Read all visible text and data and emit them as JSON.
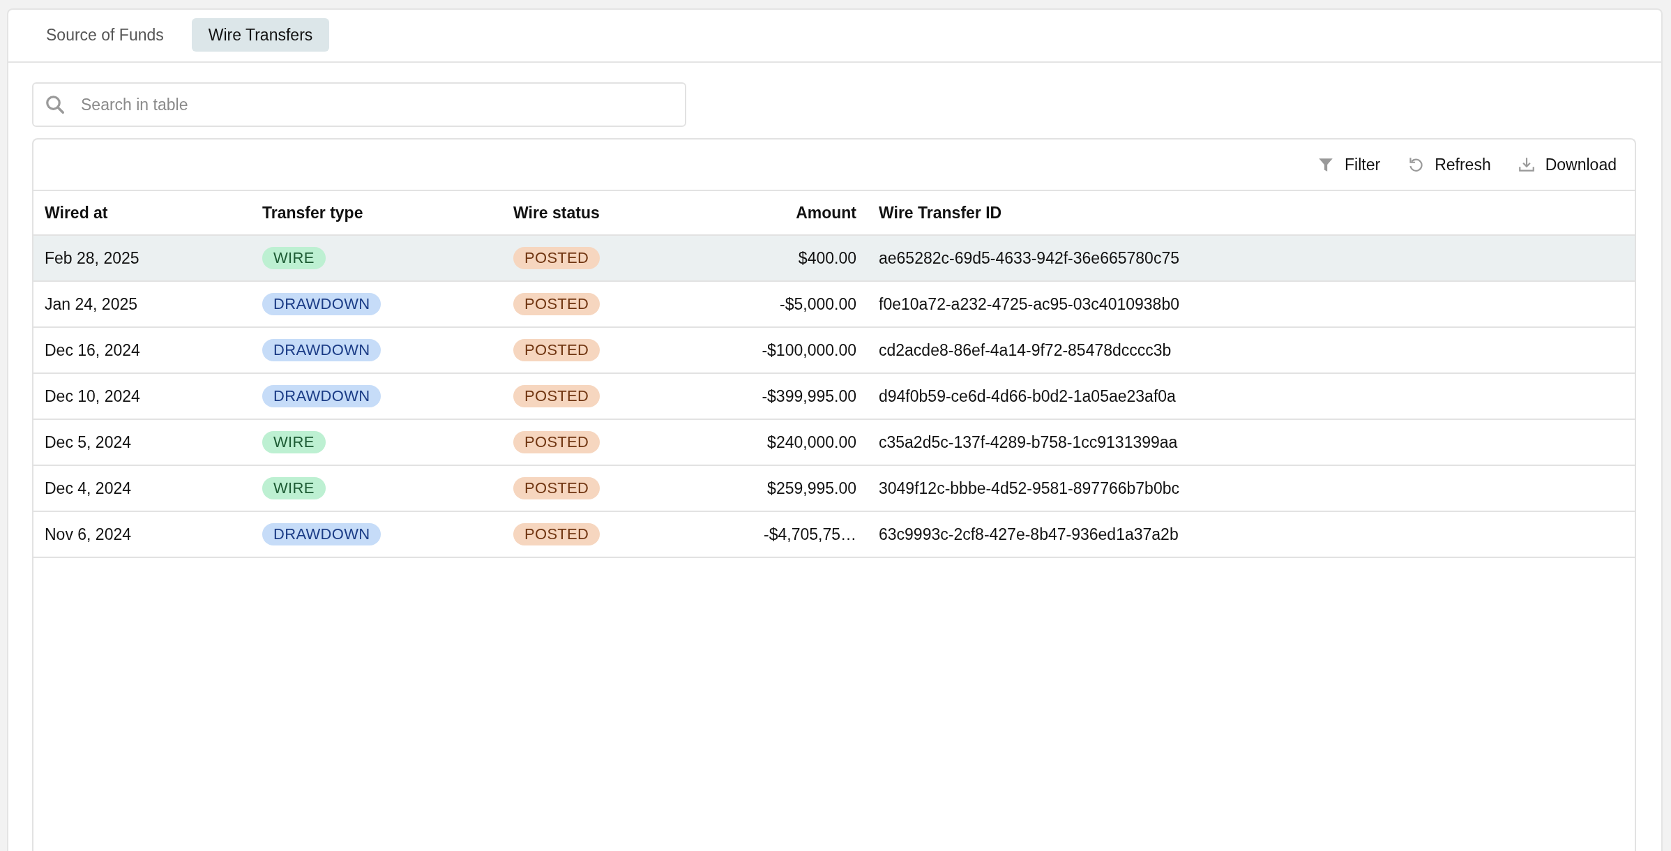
{
  "tabs": [
    {
      "label": "Source of Funds",
      "selected": false
    },
    {
      "label": "Wire Transfers",
      "selected": true
    }
  ],
  "search": {
    "placeholder": "Search in table"
  },
  "toolbar": [
    {
      "kind": "filter",
      "label": "Filter"
    },
    {
      "kind": "refresh",
      "label": "Refresh"
    },
    {
      "kind": "download",
      "label": "Download"
    }
  ],
  "table": {
    "columns": [
      "Wired at",
      "Transfer type",
      "Wire status",
      "Amount",
      "Wire Transfer ID"
    ],
    "rows": [
      {
        "wired_at": "Feb 28, 2025",
        "transfer_type": {
          "kind": "wire",
          "label": "WIRE"
        },
        "wire_status": {
          "kind": "posted",
          "label": "POSTED"
        },
        "amount": "$400.00",
        "id": "ae65282c-69d5-4633-942f-36e665780c75",
        "selected": true
      },
      {
        "wired_at": "Jan 24, 2025",
        "transfer_type": {
          "kind": "drawdown",
          "label": "DRAWDOWN"
        },
        "wire_status": {
          "kind": "posted",
          "label": "POSTED"
        },
        "amount": "-$5,000.00",
        "id": "f0e10a72-a232-4725-ac95-03c4010938b0",
        "selected": false
      },
      {
        "wired_at": "Dec 16, 2024",
        "transfer_type": {
          "kind": "drawdown",
          "label": "DRAWDOWN"
        },
        "wire_status": {
          "kind": "posted",
          "label": "POSTED"
        },
        "amount": "-$100,000.00",
        "id": "cd2acde8-86ef-4a14-9f72-85478dcccc3b",
        "selected": false
      },
      {
        "wired_at": "Dec 10, 2024",
        "transfer_type": {
          "kind": "drawdown",
          "label": "DRAWDOWN"
        },
        "wire_status": {
          "kind": "posted",
          "label": "POSTED"
        },
        "amount": "-$399,995.00",
        "id": "d94f0b59-ce6d-4d66-b0d2-1a05ae23af0a",
        "selected": false
      },
      {
        "wired_at": "Dec 5, 2024",
        "transfer_type": {
          "kind": "wire",
          "label": "WIRE"
        },
        "wire_status": {
          "kind": "posted",
          "label": "POSTED"
        },
        "amount": "$240,000.00",
        "id": "c35a2d5c-137f-4289-b758-1cc9131399aa",
        "selected": false
      },
      {
        "wired_at": "Dec 4, 2024",
        "transfer_type": {
          "kind": "wire",
          "label": "WIRE"
        },
        "wire_status": {
          "kind": "posted",
          "label": "POSTED"
        },
        "amount": "$259,995.00",
        "id": "3049f12c-bbbe-4d52-9581-897766b7b0bc",
        "selected": false
      },
      {
        "wired_at": "Nov 6, 2024",
        "transfer_type": {
          "kind": "drawdown",
          "label": "DRAWDOWN"
        },
        "wire_status": {
          "kind": "posted",
          "label": "POSTED"
        },
        "amount": "-$4,705,75…",
        "id": "63c9993c-2cf8-427e-8b47-936ed1a37a2b",
        "selected": false
      }
    ]
  }
}
